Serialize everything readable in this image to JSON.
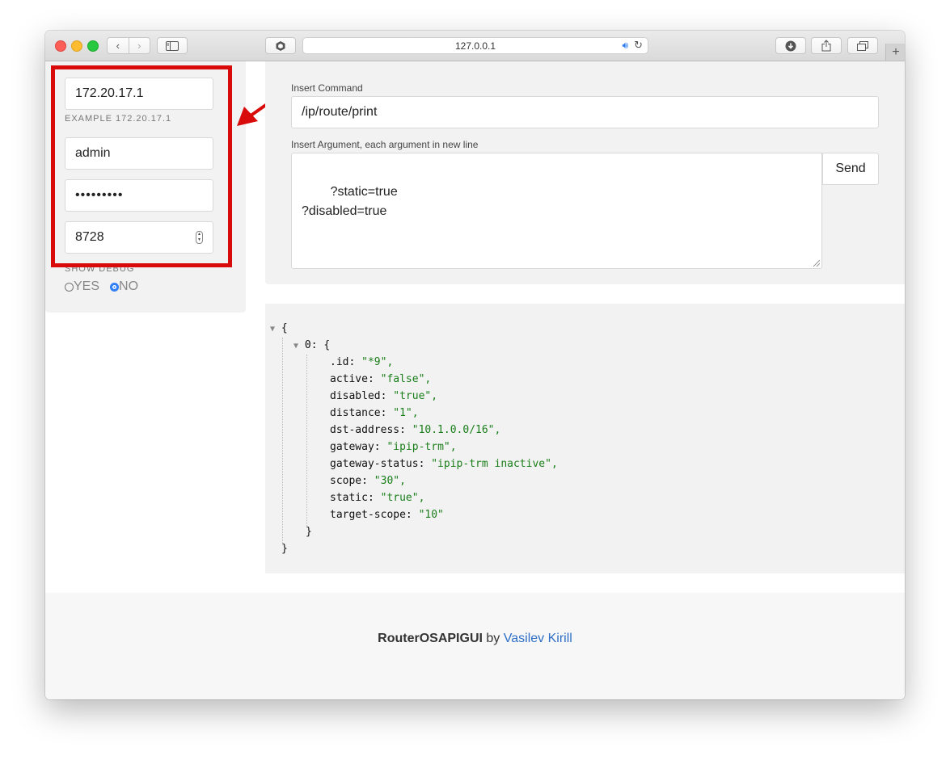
{
  "browser": {
    "url": "127.0.0.1"
  },
  "connection": {
    "host": "172.20.17.1",
    "host_example": "EXAMPLE 172.20.17.1",
    "username": "admin",
    "password_mask": "•••••••••",
    "port": "8728",
    "debug_label": "SHOW DEBUG",
    "debug_options": [
      {
        "label": "YES",
        "selected": false
      },
      {
        "label": "NO",
        "selected": true
      }
    ]
  },
  "command": {
    "command_label": "Insert Command",
    "command_value": "/ip/route/print",
    "args_label": "Insert Argument, each argument in new line",
    "args_value": "?static=true\n?disabled=true",
    "send_label": "Send"
  },
  "result": {
    "index_key": "0",
    "entries": [
      {
        "key": ".id",
        "value": "\"*9\","
      },
      {
        "key": "active",
        "value": "\"false\","
      },
      {
        "key": "disabled",
        "value": "\"true\","
      },
      {
        "key": "distance",
        "value": "\"1\","
      },
      {
        "key": "dst-address",
        "value": "\"10.1.0.0/16\","
      },
      {
        "key": "gateway",
        "value": "\"ipip-trm\","
      },
      {
        "key": "gateway-status",
        "value": "\"ipip-trm inactive\","
      },
      {
        "key": "scope",
        "value": "\"30\","
      },
      {
        "key": "static",
        "value": "\"true\","
      },
      {
        "key": "target-scope",
        "value": "\"10\""
      }
    ]
  },
  "footer": {
    "app_name": "RouterOSAPIGUI",
    "by": "by",
    "author": "Vasilev Kirill"
  },
  "colors": {
    "highlight": "#d90a0a",
    "link": "#2e6fc7",
    "json_string": "#1a7f1a"
  }
}
